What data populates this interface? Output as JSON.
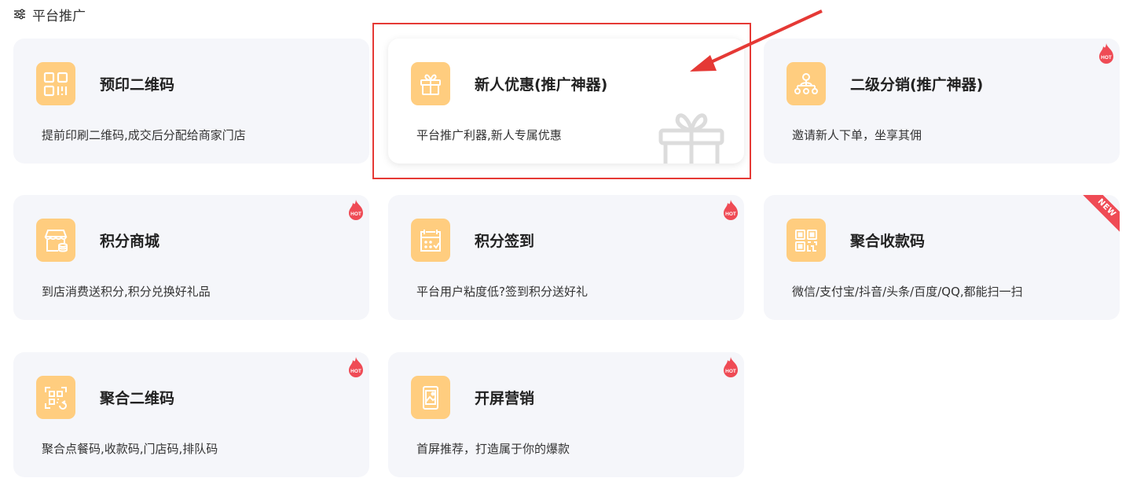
{
  "section": {
    "title": "平台推广",
    "icon": "filter-sliders-icon"
  },
  "colors": {
    "icon_bg": "#ffcd7f",
    "card_bg": "#f5f6fa",
    "hot": "#ef4b55",
    "highlight": "#e53935"
  },
  "cards": [
    {
      "title": "预印二维码",
      "desc": "提前印刷二维码,成交后分配给商家门店",
      "icon": "qr-code-icon",
      "badge": ""
    },
    {
      "title": "新人优惠(推广神器)",
      "desc": "平台推广利器,新人专属优惠",
      "icon": "gift-icon",
      "badge": "",
      "highlighted": true
    },
    {
      "title": "二级分销(推广神器)",
      "desc": "邀请新人下单，坐享其佣",
      "icon": "network-icon",
      "badge": "HOT"
    },
    {
      "title": "积分商城",
      "desc": "到店消费送积分,积分兑换好礼品",
      "icon": "store-icon",
      "badge": "HOT"
    },
    {
      "title": "积分签到",
      "desc": "平台用户粘度低?签到积分送好礼",
      "icon": "calendar-icon",
      "badge": "HOT"
    },
    {
      "title": "聚合收款码",
      "desc": "微信/支付宝/抖音/头条/百度/QQ,都能扫一扫",
      "icon": "qr-grid-icon",
      "badge": "NEW"
    },
    {
      "title": "聚合二维码",
      "desc": "聚合点餐码,收款码,门店码,排队码",
      "icon": "scan-qr-icon",
      "badge": "HOT"
    },
    {
      "title": "开屏营销",
      "desc": "首屏推荐，打造属于你的爆款",
      "icon": "splash-screen-icon",
      "badge": "HOT"
    }
  ]
}
